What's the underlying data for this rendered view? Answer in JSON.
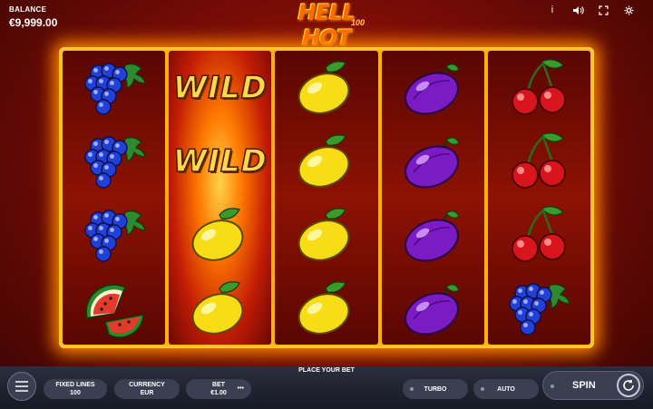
{
  "balance": {
    "label": "BALANCE",
    "value": "€9,999.00"
  },
  "logo": {
    "title": "HELL HOT",
    "subtitle": "100"
  },
  "top_icons": [
    "info-icon",
    "sound-icon",
    "fullscreen-icon",
    "settings-icon"
  ],
  "reels": [
    [
      "grapes",
      "grapes",
      "grapes",
      "watermelon"
    ],
    [
      "wild",
      "wild",
      "lemon",
      "lemon"
    ],
    [
      "lemon",
      "lemon",
      "lemon",
      "lemon"
    ],
    [
      "plum",
      "plum",
      "plum",
      "plum"
    ],
    [
      "cherries",
      "cherries",
      "cherries",
      "grapes"
    ]
  ],
  "wild_text": "WILD",
  "bottom": {
    "place_bet": "PLACE YOUR BET",
    "fixed_lines_label": "FIXED LINES",
    "fixed_lines_value": "100",
    "currency_label": "CURRENCY",
    "currency_value": "EUR",
    "bet_label": "BET",
    "bet_value": "€1.00",
    "turbo": "TURBO",
    "auto": "AUTO",
    "spin": "SPIN"
  },
  "colors": {
    "accent": "#ff8a00",
    "reel_frame": "#ffb000",
    "ui_bar": "#2b2e3d"
  }
}
